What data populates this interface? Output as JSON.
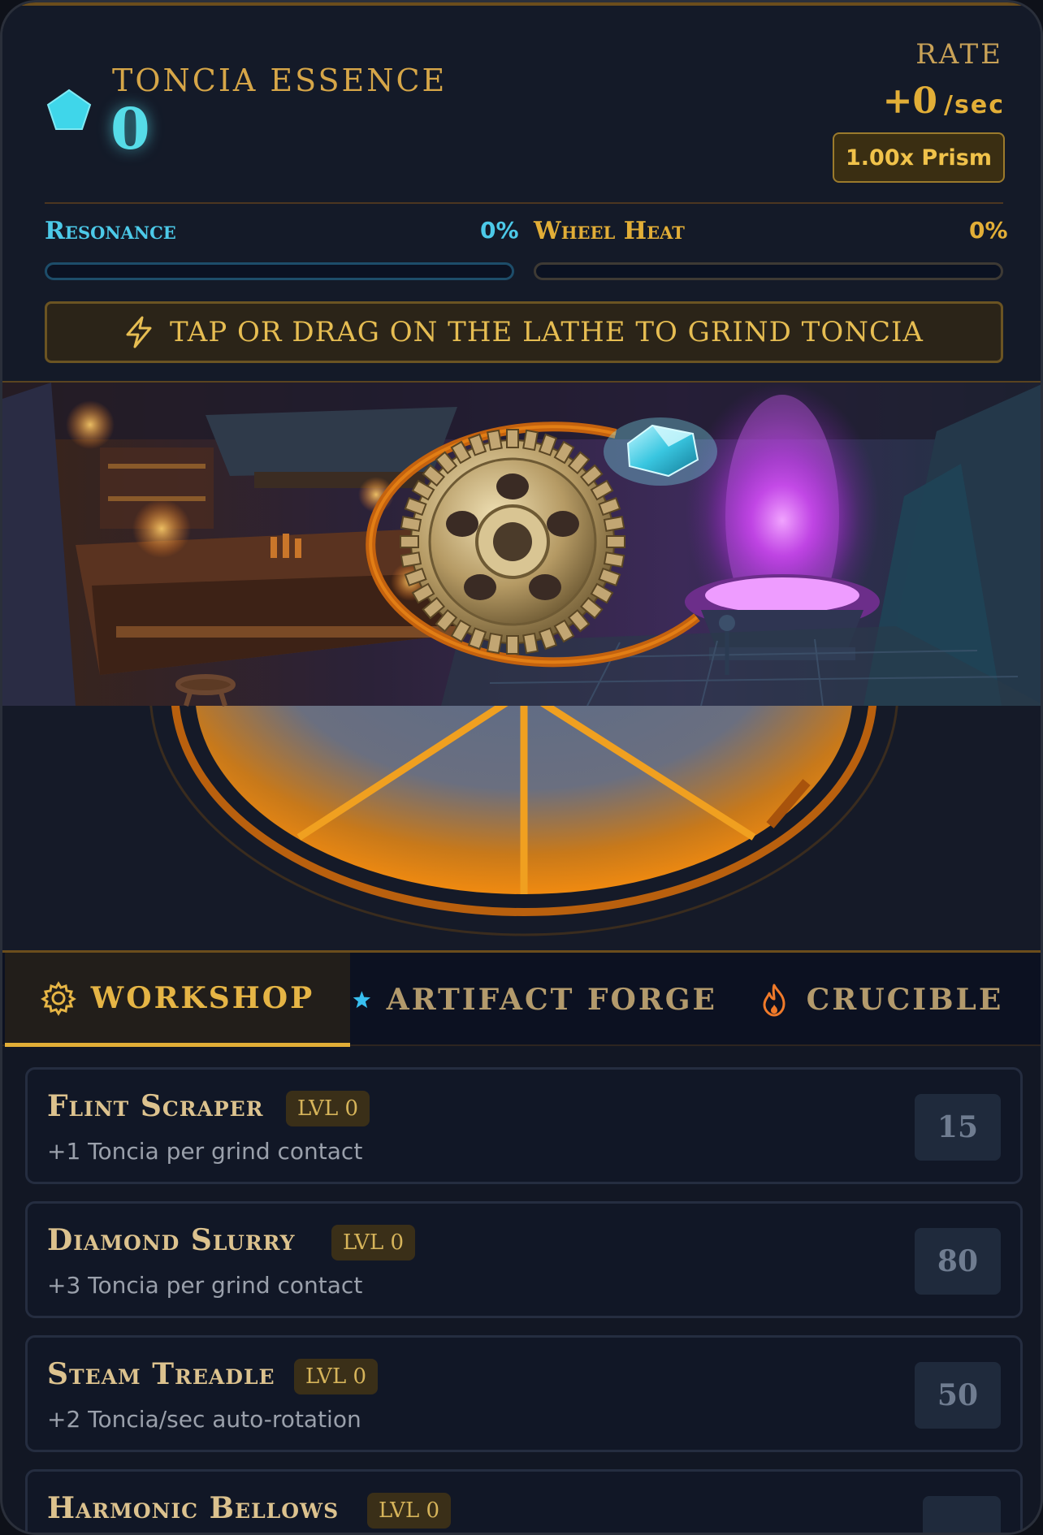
{
  "header": {
    "currency_name": "TONCIA ESSENCE",
    "currency_value": "0",
    "rate_label": "RATE",
    "rate_value": "+0",
    "rate_unit": "/sec",
    "prism_multiplier": "1.00x Prism",
    "resonance": {
      "label": "Resonance",
      "percent_text": "0%",
      "level": 0
    },
    "wheel_heat": {
      "label": "Wheel Heat",
      "percent_text": "0%",
      "level": 0
    },
    "hint": "TAP OR DRAG ON THE LATHE TO GRIND TONCIA"
  },
  "icons": {
    "currency": "gem-icon",
    "hint": "lightning-icon",
    "workshop": "gear-icon",
    "forge": "star-icon",
    "crucible": "flame-icon"
  },
  "colors": {
    "essence": "#56dce8",
    "gold": "#e2ae37",
    "resonance": "#4cc9e8",
    "background": "#121724"
  },
  "tabs": [
    {
      "label": "WORKSHOP",
      "active": true
    },
    {
      "label": "ARTIFACT FORGE",
      "active": false
    },
    {
      "label": "CRUCIBLE",
      "active": false
    }
  ],
  "upgrades": [
    {
      "name": "Flint Scraper",
      "level": "LVL 0",
      "description": "+1 Toncia per grind contact",
      "cost": "15"
    },
    {
      "name": "Diamond Slurry",
      "level": "LVL 0",
      "description": "+3 Toncia per grind contact",
      "cost": "80"
    },
    {
      "name": "Steam Treadle",
      "level": "LVL 0",
      "description": "+2 Toncia/sec auto-rotation",
      "cost": "50"
    },
    {
      "name": "Harmonic Bellows",
      "level": "LVL 0",
      "description": "",
      "cost": ""
    }
  ]
}
